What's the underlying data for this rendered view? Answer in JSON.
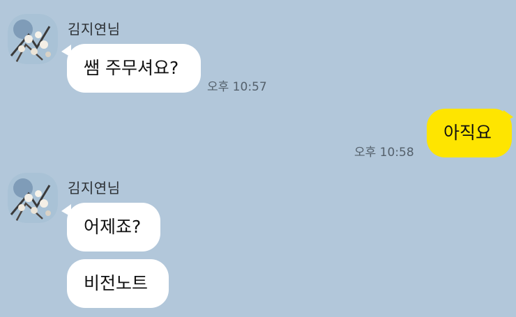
{
  "colors": {
    "background": "#b2c7da",
    "incoming_bubble": "#ffffff",
    "outgoing_bubble": "#fee500",
    "timestamp": "#54606b"
  },
  "messages": [
    {
      "direction": "incoming",
      "sender": "김지연님",
      "avatar_icon": "profile-photo-icon",
      "bubbles": [
        "쌤 주무셔요?"
      ],
      "time": "오후 10:57"
    },
    {
      "direction": "outgoing",
      "bubbles": [
        "아직요"
      ],
      "time": "오후 10:58"
    },
    {
      "direction": "incoming",
      "sender": "김지연님",
      "avatar_icon": "profile-photo-icon",
      "bubbles": [
        "어제죠?",
        "비전노트"
      ]
    }
  ]
}
